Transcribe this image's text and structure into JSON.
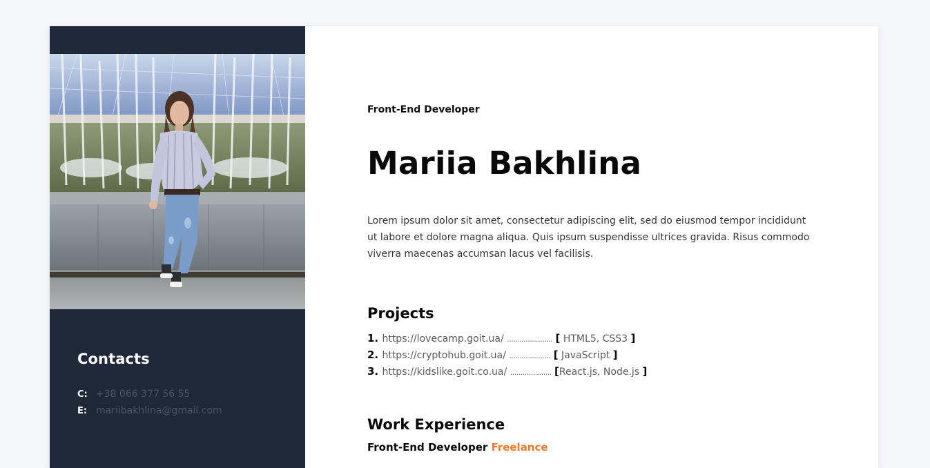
{
  "header": {
    "role": "Front-End Developer",
    "name": "Mariia Bakhlina"
  },
  "about": {
    "text": "Lorem ipsum dolor sit amet, consectetur adipiscing elit, sed do eiusmod tempor incididunt ut labore et dolore magna aliqua. Quis ipsum suspendisse ultrices gravida. Risus commodo viverra maecenas accumsan lacus vel facilisis."
  },
  "sidebar": {
    "photo_icon": "profile-photo",
    "contacts_title": "Contacts",
    "contacts": [
      {
        "key": "C:",
        "value": "+38 066 377 56 55"
      },
      {
        "key": "E:",
        "value": "mariibakhlina@gmail.com"
      }
    ]
  },
  "projects": {
    "title": "Projects",
    "items": [
      {
        "num": "1.",
        "url": "https://lovecamp.goit.ua/",
        "dots": "......................",
        "open": "[",
        "tech": " HTML5, CSS3",
        "close": "]"
      },
      {
        "num": "2.",
        "url": "https://cryptohub.goit.ua/",
        "dots": "....................",
        "open": "[",
        "tech": " JavaScript",
        "close": "]"
      },
      {
        "num": "3.",
        "url": "https://kidslike.goit.co.ua/",
        "dots": "....................",
        "open": "[",
        "tech": "React.js, Node.js",
        "close": "]"
      }
    ]
  },
  "work": {
    "title": "Work Experience",
    "position": "Front-End Developer",
    "company": "Freelance"
  },
  "colors": {
    "sidebar_bg": "#1f2838",
    "accent": "#f07a2b",
    "page_bg": "#f5f6f9"
  }
}
